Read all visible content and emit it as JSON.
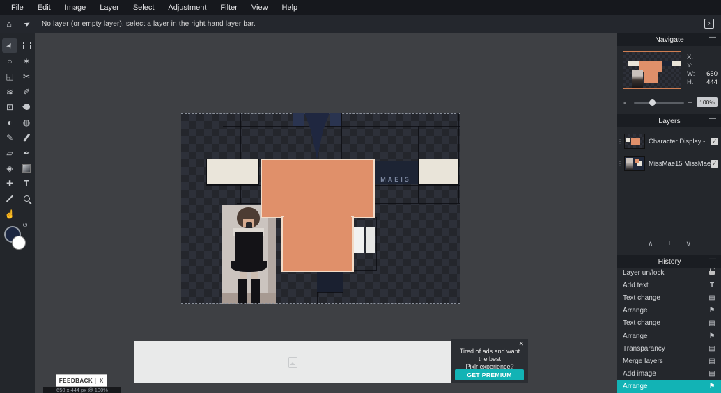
{
  "menubar": {
    "items": [
      "File",
      "Edit",
      "Image",
      "Layer",
      "Select",
      "Adjustment",
      "Filter",
      "View",
      "Help"
    ]
  },
  "notice": {
    "text": "No layer (or empty layer), select a layer in the right hand layer bar."
  },
  "icons": {
    "home": "⌂",
    "pointer": "➤",
    "expand": "›",
    "minimize": "—",
    "swap": "↺",
    "layer_up": "∧",
    "layer_add": "+",
    "layer_down": "∨",
    "flag": "⚑",
    "page": "▤",
    "text_tool": "T",
    "check": "✓",
    "grip": "⋮⋮",
    "close": "✕"
  },
  "tools": [
    "move",
    "marquee",
    "lasso",
    "wand",
    "crop",
    "cutout",
    "liquify",
    "pen",
    "clone",
    "heal",
    "dodge-burn",
    "sponge",
    "pencil",
    "brush",
    "eraser",
    "ink",
    "fill",
    "gradient",
    "patch",
    "text",
    "eyedropper",
    "zoom",
    "hand"
  ],
  "canvas": {
    "skin_text": "MAEIS"
  },
  "navigate": {
    "title": "Navigate",
    "x_label": "X:",
    "x_value": "",
    "y_label": "Y:",
    "y_value": "",
    "w_label": "W:",
    "w_value": "650",
    "h_label": "H:",
    "h_value": "444",
    "zoom_out": "-",
    "zoom_in": "+",
    "zoom_value": "100%"
  },
  "layers": {
    "title": "Layers",
    "items": [
      {
        "name": "Character Display - ...",
        "visible": true
      },
      {
        "name": "MissMae15 MissMae...",
        "visible": true
      }
    ]
  },
  "history": {
    "title": "History",
    "items": [
      {
        "label": "Layer un/lock",
        "icon": "lock-icon",
        "active": false
      },
      {
        "label": "Add text",
        "icon": "text-icon",
        "active": false
      },
      {
        "label": "Text change",
        "icon": "page-icon",
        "active": false
      },
      {
        "label": "Arrange",
        "icon": "flag-icon",
        "active": false
      },
      {
        "label": "Text change",
        "icon": "page-icon",
        "active": false
      },
      {
        "label": "Arrange",
        "icon": "flag-icon",
        "active": false
      },
      {
        "label": "Transparancy",
        "icon": "page-icon",
        "active": false
      },
      {
        "label": "Merge layers",
        "icon": "page-icon",
        "active": false
      },
      {
        "label": "Add image",
        "icon": "page-icon",
        "active": false
      },
      {
        "label": "Arrange",
        "icon": "flag-icon",
        "active": true
      }
    ]
  },
  "statusbar": {
    "feedback_label": "FEEDBACK",
    "feedback_close": "X",
    "size_text": "650 x 444 px @ 100%"
  },
  "ad": {
    "message_line1": "Tired of ads and want the best",
    "message_line2": "Pixlr experience?",
    "cta": "GET PREMIUM",
    "close": "✕"
  },
  "colors": {
    "accent_teal": "#12b3b5",
    "skin_orange": "#e0906a",
    "navy": "#1d2434",
    "foreground_color": "#1c2742",
    "background_color": "#ffffff"
  }
}
